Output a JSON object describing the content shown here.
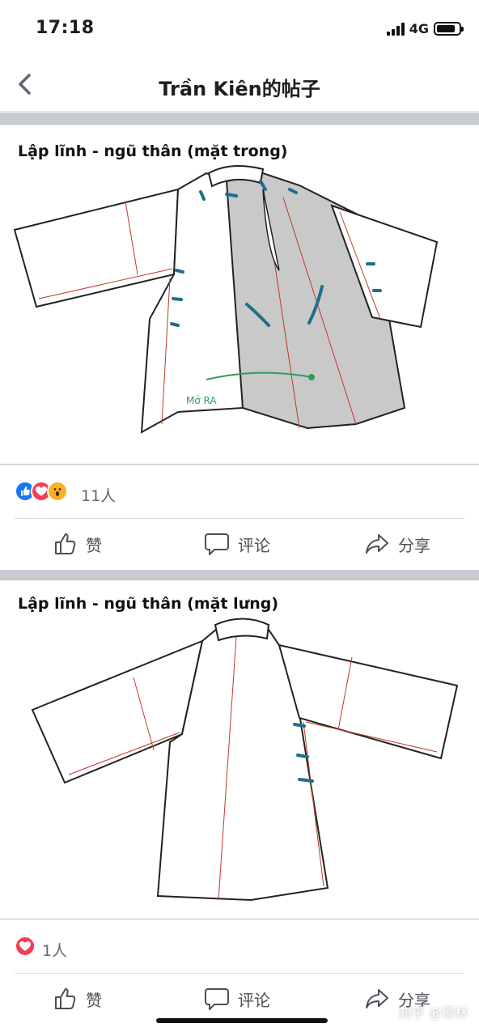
{
  "status": {
    "time": "17:18",
    "network": "4G"
  },
  "nav": {
    "title": "Trần Kiên的帖子"
  },
  "posts": [
    {
      "image_title": "Lập lĩnh - ngũ thân (mặt trong)",
      "annotation": "Mở RA",
      "reaction_count": "11人"
    },
    {
      "image_title": "Lập lĩnh - ngũ thân (mặt lưng)",
      "reaction_count": "1人"
    }
  ],
  "actions": {
    "like": "赞",
    "comment": "评论",
    "share": "分享"
  },
  "watermark": "知乎 @谭林",
  "colors": {
    "like": "#1877f2",
    "love": "#f33e58",
    "wow": "#f7b125",
    "fabric": "#c9c9c9",
    "toggle": "#1f6f8b",
    "seam": "#c0392b",
    "arrow": "#2e9e5b"
  },
  "icons": [
    "back-chevron-icon",
    "thumbs-up-icon",
    "comment-bubble-icon",
    "share-arrow-icon",
    "like-reaction-icon",
    "love-reaction-icon",
    "wow-reaction-icon"
  ]
}
